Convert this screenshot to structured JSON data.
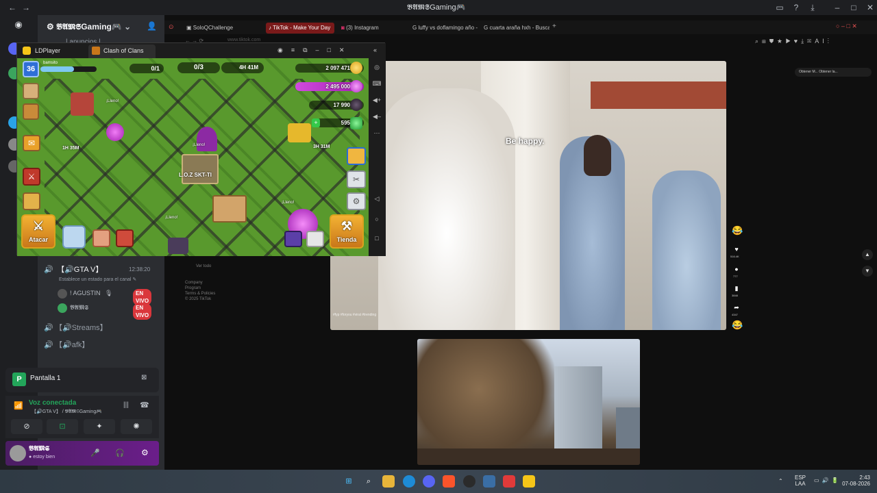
{
  "discord": {
    "window_title": "𝕭𝕬𝕸𝕾Gaming🎮",
    "server_name": "𝕭𝕬𝕸𝕾Gaming🎮",
    "channels": [
      {
        "name": "【🔊GTA V】",
        "time": "12:38:20",
        "status_hint": "Establece un estado para el canal"
      },
      {
        "name": "【🔊Streams】"
      },
      {
        "name": "【🔊afk】"
      }
    ],
    "voice_users": [
      {
        "name": "! AGUSTIN",
        "badge": "EN VIVO"
      },
      {
        "name": "𝕭𝕬𝕸𝕾",
        "badge": "EN VIVO"
      }
    ],
    "stream_title": "Pantalla 1",
    "voice_status": "Voz conectada",
    "voice_location": "【🔊GTA V】 / 𝕭𝕬𝕸𝕾Gaming🎮",
    "user_name": "𝕭𝕬𝕸𝕾",
    "user_status": "estoy bien",
    "top_partial": "| anuncios |"
  },
  "browser": {
    "tabs": [
      {
        "label": "SoloQChallenge",
        "active": false
      },
      {
        "label": "TikTok - Make Your Day",
        "active": true
      },
      {
        "label": "(3) Instagram",
        "active": false
      },
      {
        "label": "luffy vs doflamingo año -",
        "active": false
      },
      {
        "label": "cuarta araña hxh - Buscar",
        "active": false
      }
    ],
    "address": "www.tiktok.com",
    "caption": "Be happy.",
    "top_buttons": [
      "Obtener M...",
      "Obtener la..."
    ],
    "left_links": [
      "Ver todo",
      "Company",
      "Program",
      "Terms & Policies",
      "© 2025 TikTok"
    ],
    "actions": [
      "516.4K",
      "777",
      "3848",
      "4347"
    ]
  },
  "ldplayer": {
    "title": "LDPlayer",
    "tab": "Clash of Clans",
    "game": {
      "level": "36",
      "player": "bamsito",
      "builders": "0/1",
      "workers": "0/3",
      "shield": "4H 41M",
      "gold": "2 097 471",
      "elixir": "2 495 000",
      "dark_elixir": "17 990",
      "gems": "595",
      "timer1": "1H 35M",
      "timer2": "3H 31M",
      "clan_name": "L.O.Z SKT-TI",
      "attack_label": "Atacar",
      "shop_label": "Tienda",
      "labels": [
        "¡Lleno!",
        "¡Lleno!",
        "¡Lleno!",
        "¡Lleno!"
      ],
      "colors": {
        "gold": "#f5c518",
        "elixir": "#d14adf",
        "dark": "#2a1f2e",
        "gems": "#35c94a"
      }
    }
  },
  "taskbar": {
    "lang": "ESP",
    "region": "LAA",
    "time": "2:43",
    "date": "07-08-2026"
  }
}
